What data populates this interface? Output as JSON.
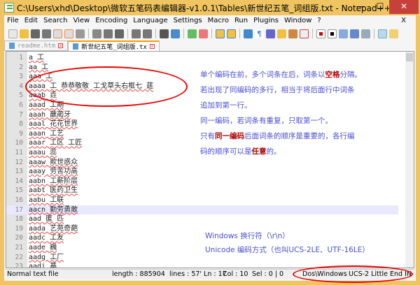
{
  "window": {
    "title": "C:\\Users\\xhd\\Desktop\\微软五笔码表编辑器-v1.0.1\\Tables\\新世纪五笔_词组版.txt - Notepad++",
    "minimize": "—",
    "maximize": "☐",
    "close": "✕"
  },
  "menu": [
    "File",
    "Edit",
    "Search",
    "View",
    "Encoding",
    "Language",
    "Settings",
    "Macro",
    "Run",
    "Plugins",
    "Window",
    "?"
  ],
  "menu_close": "X",
  "tabs": [
    {
      "label": "readme.htm",
      "active": false
    },
    {
      "label": "新世纪五笔_词组版.tx",
      "active": true
    }
  ],
  "lines": [
    {
      "n": "1",
      "t": "a 工"
    },
    {
      "n": "2",
      "t": "aa 工"
    },
    {
      "n": "3",
      "t": "aaa 工"
    },
    {
      "n": "4",
      "t": "aaaa 工 恭恭敬敬 工戈草头右框七 莛"
    },
    {
      "n": "5",
      "t": "aaab 垚"
    },
    {
      "n": "6",
      "t": "aaad 工期"
    },
    {
      "n": "7",
      "t": "aaah 蘸蔺牙"
    },
    {
      "n": "8",
      "t": "aaal 花花世界"
    },
    {
      "n": "9",
      "t": "aaan 工艺"
    },
    {
      "n": "10",
      "t": "aaar 工区 工匠"
    },
    {
      "n": "11",
      "t": "aaau 蕊"
    },
    {
      "n": "12",
      "t": "aaaw 欺世惑众"
    },
    {
      "n": "13",
      "t": "aaay 劳苦功高"
    },
    {
      "n": "14",
      "t": "aabn 工薪阶层"
    },
    {
      "n": "15",
      "t": "aabt 医药卫生"
    },
    {
      "n": "16",
      "t": "aabu 工联"
    },
    {
      "n": "17",
      "t": "aacn 勤劳勇敢"
    },
    {
      "n": "18",
      "t": "aad 匿 匹"
    },
    {
      "n": "19",
      "t": "aada 艺苑奇葩"
    },
    {
      "n": "20",
      "t": "aadc 工友"
    },
    {
      "n": "21",
      "t": "aade 巍"
    },
    {
      "n": "22",
      "t": "aadg 工厂"
    },
    {
      "n": "23",
      "t": "aadi 基"
    }
  ],
  "current_line": 17,
  "notes": {
    "n1a": "单个编码在前，多个词条在后，词条以",
    "n1b": "空格",
    "n1c": "分隔。",
    "n2": "若出现了同编码的多行，相当于将后面行中词条",
    "n3": "追加到第一行。",
    "n4": "同一编码，若词条有重复，只取第一个。",
    "n5a": "只有",
    "n5b": "同一编码",
    "n5c": "后面词条的顺序是重要的，各行编",
    "n6a": "码的顺序可以是",
    "n6b": "任意",
    "n6c": "的。",
    "n7": "Windows 换行符（\\r\\n）",
    "n8": "Unicode 编码方式（也叫UCS-2LE、UTF-16LE）"
  },
  "status": {
    "type": "Normal text file",
    "length": "length : 885904",
    "lines": "lines : 57' Ln : 17",
    "col": "Col : 10",
    "sel": "Sel : 0 | 0",
    "eol": "Dos\\Windows",
    "encoding": "UCS-2 Little End IN"
  },
  "colors": {
    "frame": "#f0c460",
    "annotation": "#e00000",
    "note_text": "#4a4ed0",
    "highlight": "#a00000"
  }
}
